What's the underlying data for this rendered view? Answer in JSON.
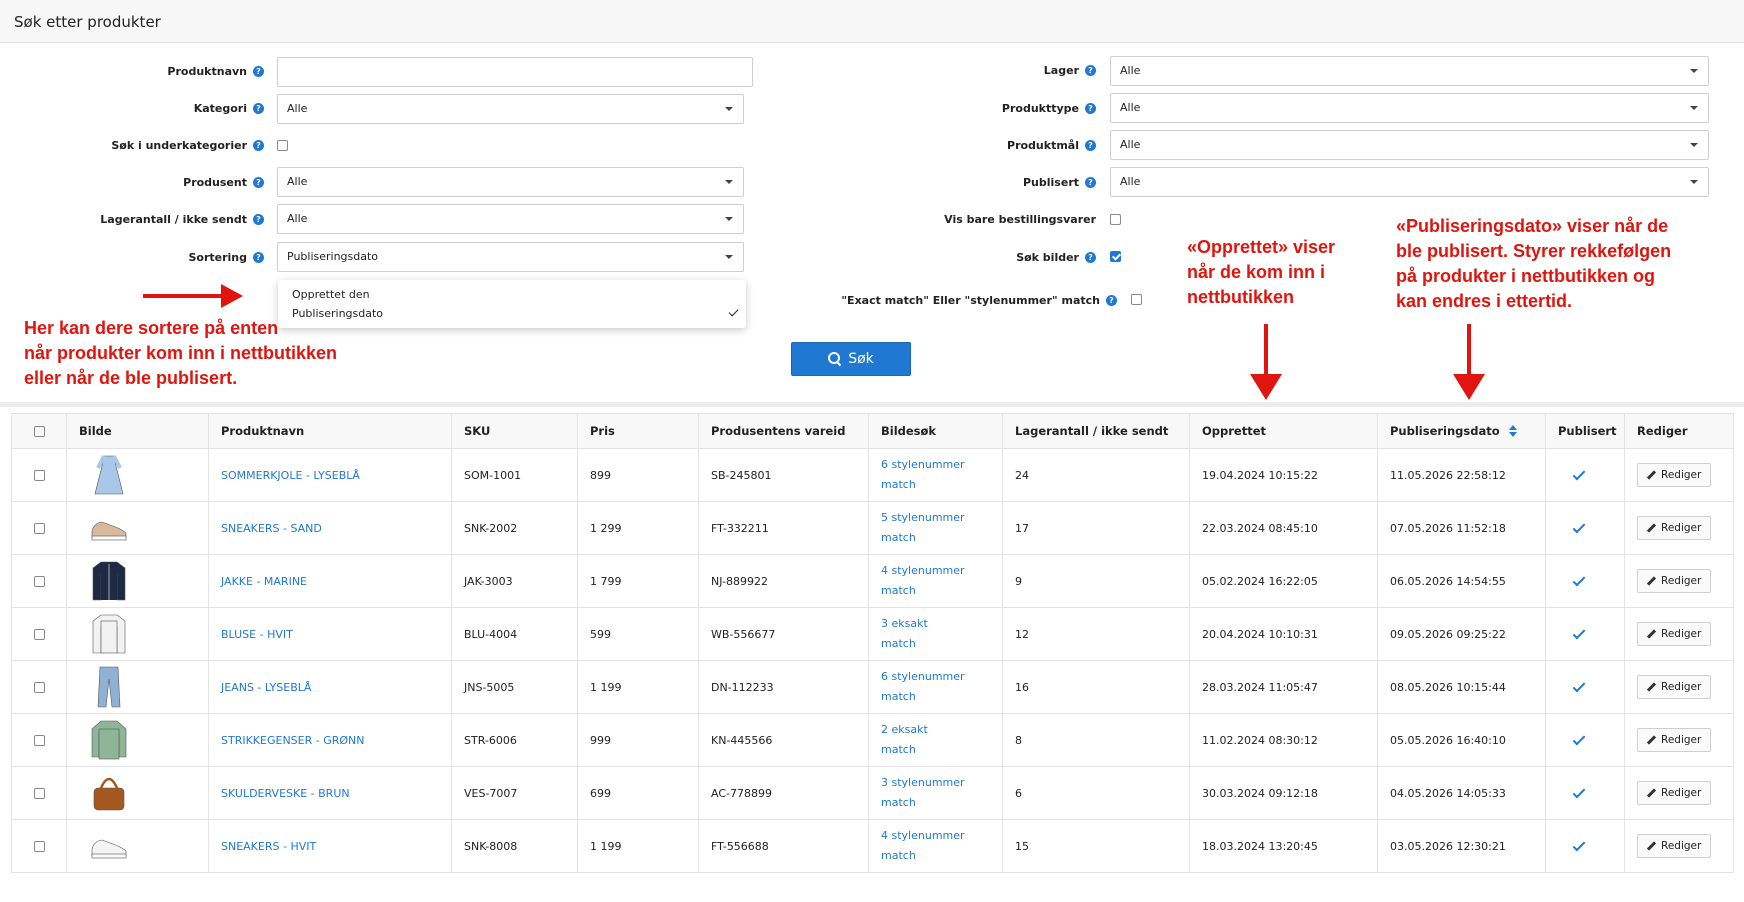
{
  "header": {
    "title": "Søk etter produkter"
  },
  "form": {
    "left": {
      "produktnavn_label": "Produktnavn",
      "produktnavn_value": "",
      "kategori_label": "Kategori",
      "kategori_value": "Alle",
      "underkategorier_label": "Søk i underkategorier",
      "produsent_label": "Produsent",
      "produsent_value": "Alle",
      "lagerantall_label": "Lagerantall / ikke sendt",
      "lagerantall_value": "Alle",
      "sortering_label": "Sortering",
      "sortering_value": "Publiseringsdato"
    },
    "right": {
      "lager_label": "Lager",
      "lager_value": "Alle",
      "produkttype_label": "Produkttype",
      "produkttype_value": "Alle",
      "produktmal_label": "Produktmål",
      "produktmal_value": "Alle",
      "publisert_label": "Publisert",
      "publisert_value": "Alle",
      "bestillingsvarer_label": "Vis bare bestillingsvarer",
      "sok_bilder_label": "Søk bilder",
      "exact_match_label": "\"Exact match\" Eller \"stylenummer\" match"
    },
    "sort_options": [
      "Opprettet den",
      "Publiseringsdato"
    ],
    "search_button": "Søk"
  },
  "annotations": {
    "left_lines": [
      "Her kan dere sortere på enten",
      "når produkter kom inn i nettbutikken",
      "eller når de ble publisert."
    ],
    "middle_lines": [
      "«Opprettet» viser",
      "når de kom inn i",
      "nettbutikken"
    ],
    "right_lines": [
      "«Publiseringsdato» viser når de",
      "ble publisert. Styrer rekkefølgen",
      "på produkter i nettbutikken og",
      "kan endres i ettertid."
    ],
    "color": "#e0150f"
  },
  "table": {
    "headers": [
      "Bilde",
      "Produktnavn",
      "SKU",
      "Pris",
      "Produsentens vareid",
      "Bildesøk",
      "Lagerantall / ikke sendt",
      "Opprettet",
      "Publiseringsdato",
      "Publisert",
      "Rediger"
    ],
    "edit_label": "Rediger",
    "rows": [
      {
        "image": "dress",
        "color": "#a9c7e8",
        "name": "SOMMERKJOLE - LYSEBLÅ",
        "sku": "SOM-1001",
        "price": "899",
        "vendor_id": "SB-245801",
        "match_1": "6 stylenummer",
        "match_2": "match",
        "stock": "24",
        "created": "19.04.2024 10:15:22",
        "published_date": "11.05.2026 22:58:12"
      },
      {
        "image": "sneaker",
        "color": "#d9b99b",
        "name": "SNEAKERS - SAND",
        "sku": "SNK-2002",
        "price": "1 299",
        "vendor_id": "FT-332211",
        "match_1": "5 stylenummer",
        "match_2": "match",
        "stock": "17",
        "created": "22.03.2024 08:45:10",
        "published_date": "07.05.2026 11:52:18"
      },
      {
        "image": "jacket",
        "color": "#1c2a44",
        "name": "JAKKE - MARINE",
        "sku": "JAK-3003",
        "price": "1 799",
        "vendor_id": "NJ-889922",
        "match_1": "4 stylenummer",
        "match_2": "match",
        "stock": "9",
        "created": "05.02.2024 16:22:05",
        "published_date": "06.05.2026 14:54:55"
      },
      {
        "image": "blouse",
        "color": "#f2f2f2",
        "name": "BLUSE - HVIT",
        "sku": "BLU-4004",
        "price": "599",
        "vendor_id": "WB-556677",
        "match_1": "3 eksakt",
        "match_2": "match",
        "stock": "12",
        "created": "20.04.2024 10:10:31",
        "published_date": "09.05.2026 09:25:22"
      },
      {
        "image": "jeans",
        "color": "#8fb1d3",
        "name": "JEANS - LYSEBLÅ",
        "sku": "JNS-5005",
        "price": "1 199",
        "vendor_id": "DN-112233",
        "match_1": "6 stylenummer",
        "match_2": "match",
        "stock": "16",
        "created": "28.03.2024 11:05:47",
        "published_date": "08.05.2026 10:15:44"
      },
      {
        "image": "sweater",
        "color": "#8fb598",
        "name": "STRIKKEGENSER - GRØNN",
        "sku": "STR-6006",
        "price": "999",
        "vendor_id": "KN-445566",
        "match_1": "2 eksakt",
        "match_2": "match",
        "stock": "8",
        "created": "11.02.2024 08:30:12",
        "published_date": "05.05.2026 16:40:10"
      },
      {
        "image": "bag",
        "color": "#a5581e",
        "name": "SKULDERVESKE - BRUN",
        "sku": "VES-7007",
        "price": "699",
        "vendor_id": "AC-778899",
        "match_1": "3 stylenummer",
        "match_2": "match",
        "stock": "6",
        "created": "30.03.2024 09:12:18",
        "published_date": "04.05.2026 14:05:33"
      },
      {
        "image": "sneaker",
        "color": "#f4f4f4",
        "name": "SNEAKERS - HVIT",
        "sku": "SNK-8008",
        "price": "1 199",
        "vendor_id": "FT-556688",
        "match_1": "4 stylenummer",
        "match_2": "match",
        "stock": "15",
        "created": "18.03.2024 13:20:45",
        "published_date": "03.05.2026 12:30:21"
      }
    ]
  },
  "colors": {
    "accent": "#1f78d1",
    "annotation": "#e0150f"
  }
}
